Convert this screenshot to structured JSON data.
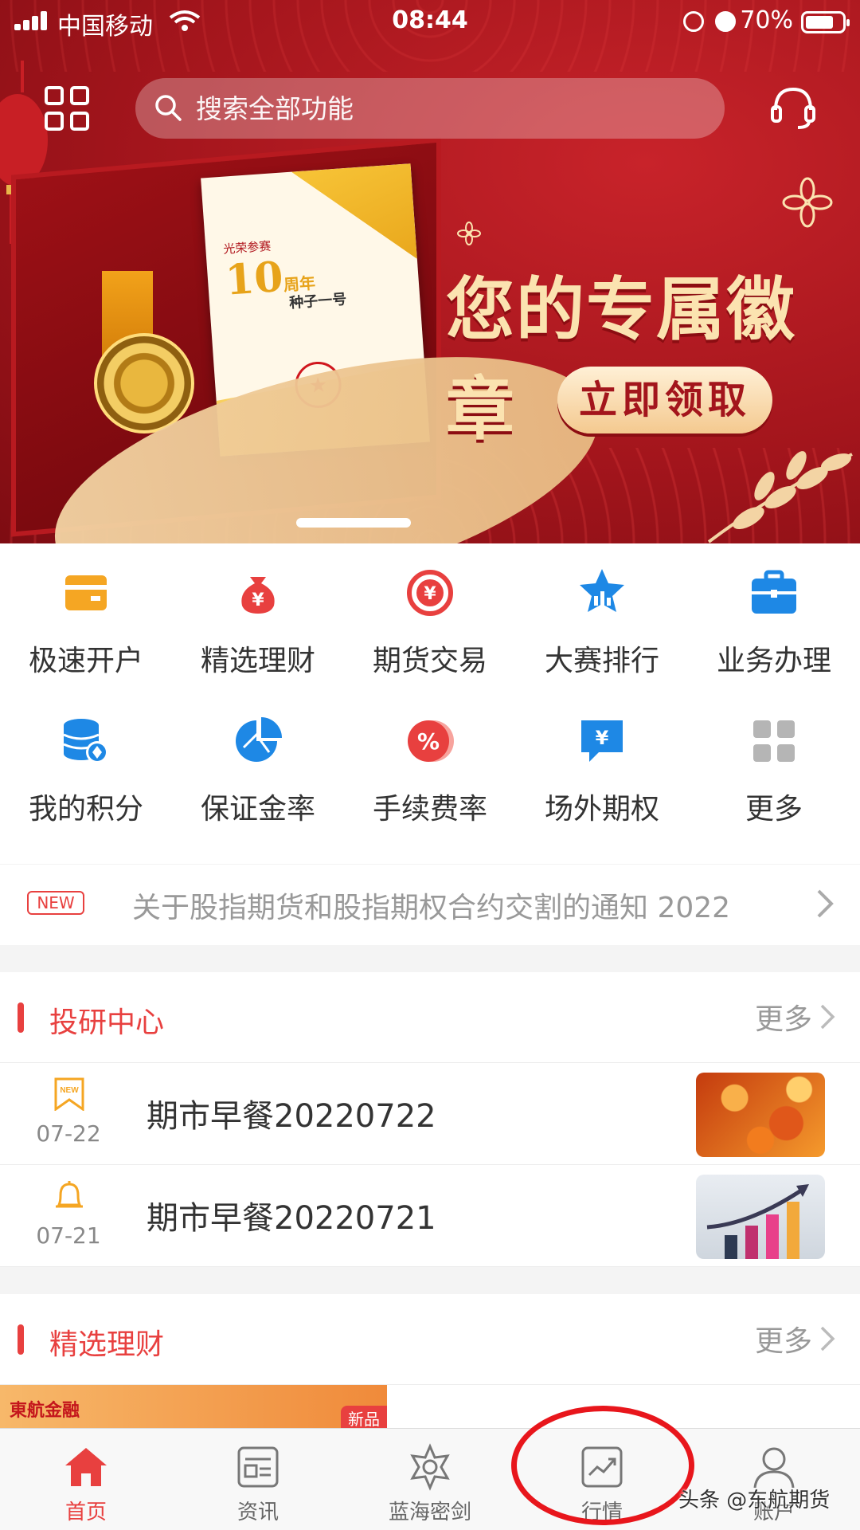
{
  "status_bar": {
    "carrier": "中国移动",
    "time": "08:44",
    "battery": "70%"
  },
  "header": {
    "search_placeholder": "搜索全部功能"
  },
  "banner": {
    "title": "您的专属徽章",
    "button": "立即领取",
    "certificate": {
      "line1": "光荣参赛",
      "line2": "10",
      "line2_suffix": "周年",
      "line3": "种子一号"
    },
    "carousel_active_index": 0
  },
  "quick_functions": [
    {
      "label": "极速开户",
      "icon": "account-card-icon",
      "color": "#f5a623"
    },
    {
      "label": "精选理财",
      "icon": "money-bag-icon",
      "color": "#e8403f"
    },
    {
      "label": "期货交易",
      "icon": "yuan-exchange-icon",
      "color": "#e8403f"
    },
    {
      "label": "大赛排行",
      "icon": "star-ranking-icon",
      "color": "#1e88e5"
    },
    {
      "label": "业务办理",
      "icon": "briefcase-icon",
      "color": "#1e88e5"
    },
    {
      "label": "我的积分",
      "icon": "database-points-icon",
      "color": "#1e88e5"
    },
    {
      "label": "保证金率",
      "icon": "pie-chart-icon",
      "color": "#1e88e5"
    },
    {
      "label": "手续费率",
      "icon": "percent-icon",
      "color": "#e8403f"
    },
    {
      "label": "场外期权",
      "icon": "yuan-chat-icon",
      "color": "#1e88e5"
    },
    {
      "label": "更多",
      "icon": "more-grid-icon",
      "color": "#b5b5b5"
    }
  ],
  "notice": {
    "tag": "NEW",
    "text": "关于股指期货和股指期权合约交割的通知 2022"
  },
  "research": {
    "title": "投研中心",
    "more": "更多",
    "items": [
      {
        "date": "07-22",
        "title": "期市早餐20220722",
        "icon": "new-ribbon-icon"
      },
      {
        "date": "07-21",
        "title": "期市早餐20220721",
        "icon": "bell-icon"
      }
    ]
  },
  "finance": {
    "title": "精选理财",
    "more": "更多",
    "banner_logo": "東航金融",
    "banner_badge": "新品"
  },
  "tabbar": [
    {
      "label": "首页",
      "icon": "home-icon",
      "active": true
    },
    {
      "label": "资讯",
      "icon": "news-icon",
      "active": false
    },
    {
      "label": "蓝海密剑",
      "icon": "sword-badge-icon",
      "active": false
    },
    {
      "label": "行情",
      "icon": "market-chart-icon",
      "active": false
    },
    {
      "label": "账户",
      "icon": "user-icon",
      "active": false
    }
  ],
  "watermark": "头条 @东航期货",
  "colors": {
    "brand_red": "#e8403f",
    "banner_red": "#a3151c",
    "accent_blue": "#1e88e5",
    "accent_orange": "#f5a623"
  }
}
